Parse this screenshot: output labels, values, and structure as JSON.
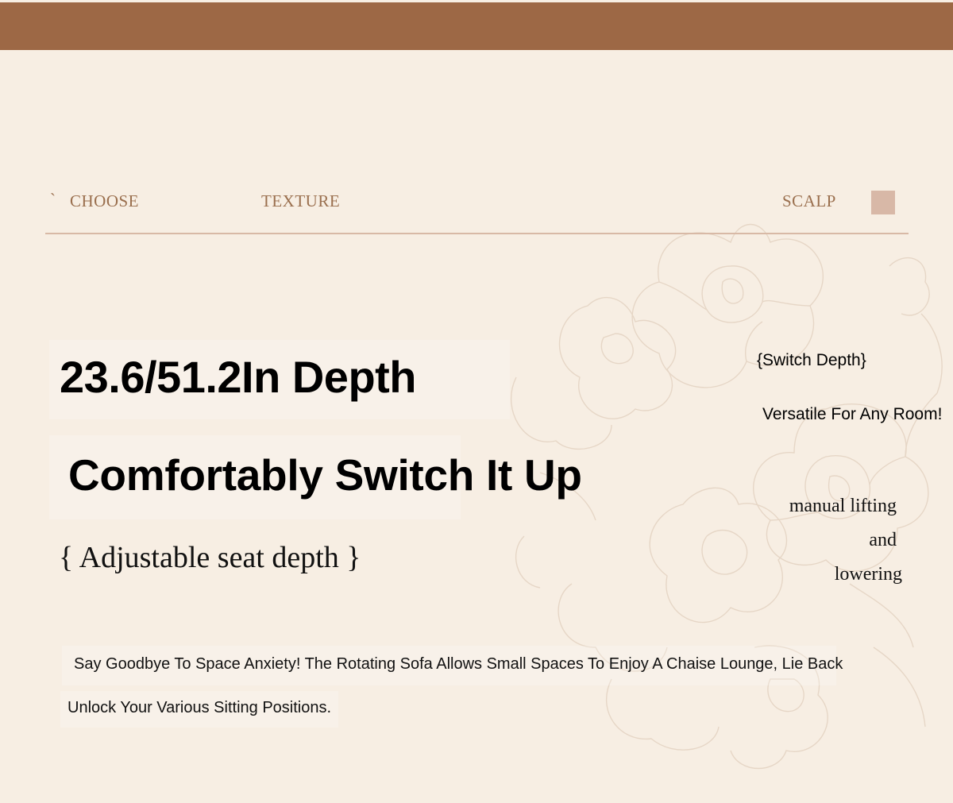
{
  "nav": {
    "tick": "`",
    "items": [
      "CHOOSE",
      "TEXTURE",
      "SCALP"
    ]
  },
  "main": {
    "depth_heading": "23.6/51.2In Depth",
    "switch_heading": "Comfortably Switch It Up",
    "subtitle": "{ Adjustable seat depth }"
  },
  "side": {
    "switch_depth": "{Switch Depth}",
    "versatile": "Versatile For Any Room!",
    "lifting_lines": [
      "manual lifting",
      "and",
      "lowering"
    ]
  },
  "description": {
    "line1": "Say Goodbye To Space Anxiety! The Rotating Sofa Allows Small Spaces To Enjoy A Chaise Lounge, Lie Back",
    "line2": "Unlock Your Various Sitting Positions."
  },
  "colors": {
    "banner": "#9d6845",
    "background": "#f7eee3",
    "nav_text": "#9a6f4e",
    "rule": "#d8b9a6",
    "accent_square": "#d8b8a7"
  },
  "decoration": {
    "background_art": "floral-line-drawing-icon"
  }
}
